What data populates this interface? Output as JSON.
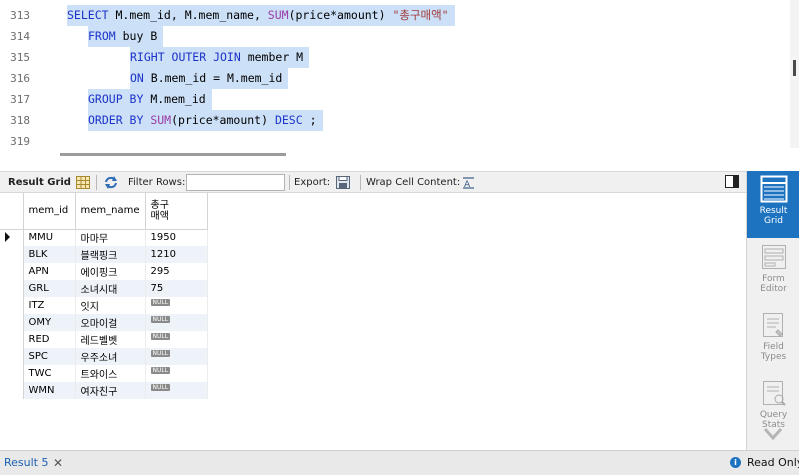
{
  "editor": {
    "lines": [
      {
        "num": "313",
        "tokens": [
          {
            "t": "SELECT ",
            "c": "kw"
          },
          {
            "t": "M.mem_id, M.mem_name, ",
            "c": ""
          },
          {
            "t": "SUM",
            "c": "fn"
          },
          {
            "t": "(price*amount) ",
            "c": ""
          },
          {
            "t": "\"총구매액\"",
            "c": "str"
          }
        ]
      },
      {
        "num": "314",
        "tokens": [
          {
            "t": "FROM ",
            "c": "kw"
          },
          {
            "t": "buy B",
            "c": ""
          }
        ]
      },
      {
        "num": "315",
        "tokens": [
          {
            "t": "RIGHT OUTER JOIN ",
            "c": "kw"
          },
          {
            "t": "member M",
            "c": ""
          }
        ]
      },
      {
        "num": "316",
        "tokens": [
          {
            "t": "ON ",
            "c": "kw"
          },
          {
            "t": "B.mem_id = M.mem_id",
            "c": ""
          }
        ]
      },
      {
        "num": "317",
        "tokens": [
          {
            "t": "GROUP BY ",
            "c": "kw"
          },
          {
            "t": "M.mem_id",
            "c": ""
          }
        ]
      },
      {
        "num": "318",
        "tokens": [
          {
            "t": "ORDER BY ",
            "c": "kw"
          },
          {
            "t": "SUM",
            "c": "fn"
          },
          {
            "t": "(price*amount) ",
            "c": ""
          },
          {
            "t": "DESC",
            "c": "kw"
          },
          {
            "t": " ;",
            "c": ""
          }
        ]
      },
      {
        "num": "319",
        "tokens": []
      }
    ]
  },
  "toolbar": {
    "result_grid_label": "Result Grid",
    "filter_rows_label": "Filter Rows:",
    "filter_value": "",
    "export_label": "Export:",
    "wrap_label": "Wrap Cell Content:"
  },
  "grid": {
    "columns": [
      "mem_id",
      "mem_name",
      "총구\n매액"
    ],
    "null_label": "NULL",
    "rows": [
      {
        "mem_id": "MMU",
        "mem_name": "마마무",
        "total": "1950"
      },
      {
        "mem_id": "BLK",
        "mem_name": "블랙핑크",
        "total": "1210"
      },
      {
        "mem_id": "APN",
        "mem_name": "에이핑크",
        "total": "295"
      },
      {
        "mem_id": "GRL",
        "mem_name": "소녀시대",
        "total": "75"
      },
      {
        "mem_id": "ITZ",
        "mem_name": "잇지",
        "total": null
      },
      {
        "mem_id": "OMY",
        "mem_name": "오마이걸",
        "total": null
      },
      {
        "mem_id": "RED",
        "mem_name": "레드벨벳",
        "total": null
      },
      {
        "mem_id": "SPC",
        "mem_name": "우주소녀",
        "total": null
      },
      {
        "mem_id": "TWC",
        "mem_name": "트와이스",
        "total": null
      },
      {
        "mem_id": "WMN",
        "mem_name": "여자친구",
        "total": null
      }
    ]
  },
  "sidepanel": {
    "result_grid": "Result\nGrid",
    "form_editor": "Form\nEditor",
    "field_types": "Field\nTypes",
    "query_stats": "Query\nStats"
  },
  "bottombar": {
    "tab_label": "Result 5",
    "close_glyph": "✕",
    "info_glyph": "i",
    "status": "Read Only"
  },
  "colors": {
    "selection": "#cce0f7",
    "keyword": "#1c33c9",
    "function": "#9a3ca7",
    "string": "#a13d3d",
    "accent": "#1e73c1"
  }
}
